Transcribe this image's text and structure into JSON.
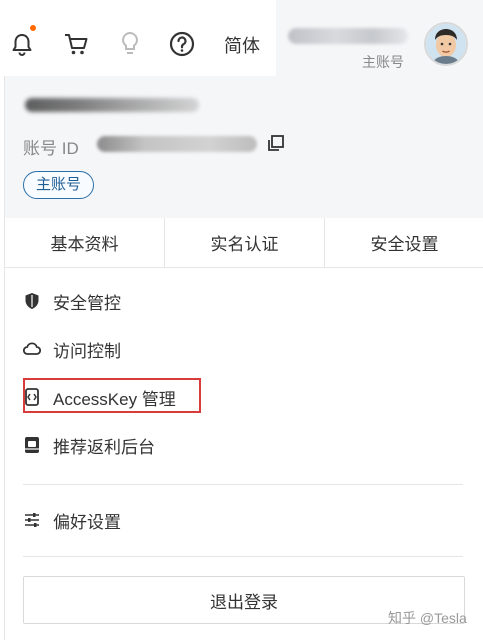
{
  "header": {
    "language": "简体",
    "account_role": "主账号",
    "icons": [
      "bell-icon",
      "cart-icon",
      "lightbulb-icon",
      "help-icon"
    ],
    "notification_dot_color": "#ff6a00"
  },
  "panel": {
    "account_id_label": "账号 ID",
    "role_badge": "主账号",
    "tabs": [
      "基本资料",
      "实名认证",
      "安全设置"
    ],
    "menu": [
      {
        "label": "安全管控",
        "icon": "shield-icon"
      },
      {
        "label": "访问控制",
        "icon": "cloud-icon"
      },
      {
        "label": "AccessKey 管理",
        "icon": "key-icon"
      },
      {
        "label": "推荐返利后台",
        "icon": "rebate-icon"
      },
      {
        "label": "偏好设置",
        "icon": "sliders-icon"
      }
    ],
    "logout_label": "退出登录",
    "highlight_color": "#d93b3b",
    "accent_color": "#1f5e95"
  },
  "watermark": "知乎 @Tesla"
}
